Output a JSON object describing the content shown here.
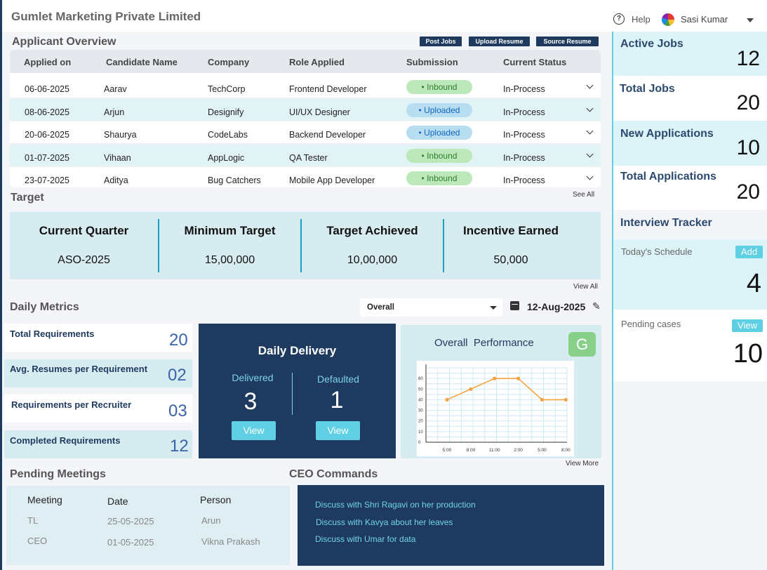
{
  "header": {
    "title": "Gumlet Marketing Private Limited",
    "help_label": "Help",
    "user_name": "Sasi Kumar"
  },
  "applicant_overview": {
    "title": "Applicant Overview",
    "buttons": [
      "Post Jobs",
      "Upload Resume",
      "Source Resume"
    ],
    "columns": [
      "Applied on",
      "Candidate Name",
      "Company",
      "Role Applied",
      "Submission",
      "Current Status"
    ],
    "rows": [
      {
        "date": "06-06-2025",
        "name": "Aarav",
        "company": "TechCorp",
        "role": "Frontend Developer",
        "submission": "• Inbound",
        "status": "In-Process"
      },
      {
        "date": "08-06-2025",
        "name": "Arjun",
        "company": "Designify",
        "role": "UI/UX Designer",
        "submission": "• Uploaded",
        "status": "In-Process"
      },
      {
        "date": "20-06-2025",
        "name": "Shaurya",
        "company": "CodeLabs",
        "role": "Backend Developer",
        "submission": "• Uploaded",
        "status": "In-Process"
      },
      {
        "date": "01-07-2025",
        "name": "Vihaan",
        "company": "AppLogic",
        "role": "QA Tester",
        "submission": "• Inbound",
        "status": "In-Process"
      },
      {
        "date": "23-07-2025",
        "name": "Aditya",
        "company": "Bug Catchers",
        "role": "Mobile App Developer",
        "submission": "• Inbound",
        "status": "In-Process"
      }
    ]
  },
  "target": {
    "title": "Target",
    "see_all": "See All",
    "view_all": "View All",
    "columns": [
      {
        "head": "Current Quarter",
        "value": "ASO-2025"
      },
      {
        "head": "Minimum Target",
        "value": "15,00,000"
      },
      {
        "head": "Target Achieved",
        "value": "10,00,000"
      },
      {
        "head": "Incentive Earned",
        "value": "50,000"
      }
    ]
  },
  "daily_metrics": {
    "title": "Daily Metrics",
    "filter_value": "Overall",
    "date": "12-Aug-2025",
    "metrics": [
      {
        "label": "Total Requirements",
        "value": "20"
      },
      {
        "label": "Avg. Resumes per Requirement",
        "value": "02"
      },
      {
        "label": "Requirements per Recruiter",
        "value": "03"
      },
      {
        "label": "Completed Requirements",
        "value": "12"
      }
    ]
  },
  "daily_delivery": {
    "title": "Daily Delivery",
    "delivered_label": "Delivered",
    "delivered_value": "3",
    "defaulted_label": "Defaulted",
    "defaulted_value": "1",
    "view_label": "View"
  },
  "performance": {
    "title": "Overall  Performance",
    "badge": "G",
    "view_more": "View More"
  },
  "chart_data": {
    "type": "line",
    "x": [
      "5:00",
      "8:00",
      "11:00",
      "2:00",
      "5:00",
      "8:00"
    ],
    "values": [
      40,
      50,
      60,
      60,
      40,
      40
    ],
    "ylim": [
      0,
      70
    ],
    "yticks": [
      0,
      10,
      20,
      30,
      40,
      50,
      60
    ],
    "grid": true,
    "color": "#f4a340"
  },
  "pending_meetings": {
    "title": "Pending Meetings",
    "columns": [
      "Meeting",
      "Date",
      "Person"
    ],
    "rows": [
      {
        "meeting": "TL",
        "date": "25-05-2025",
        "person": "Arun"
      },
      {
        "meeting": "CEO",
        "date": "01-05-2025",
        "person": "Vikna Prakash"
      }
    ]
  },
  "ceo_commands": {
    "title": "CEO Commands",
    "items": [
      "Discuss with Shri Ragavi on her production",
      "Discuss with Kavya about her leaves",
      "Discuss with Umar for data"
    ]
  },
  "sidebar": {
    "stats": [
      {
        "label": "Active Jobs",
        "value": "12"
      },
      {
        "label": "Total Jobs",
        "value": "20"
      },
      {
        "label": "New Applications",
        "value": "10"
      },
      {
        "label": "Total Applications",
        "value": "20"
      }
    ],
    "interview_tracker": "Interview Tracker",
    "schedule_label": "Today's Schedule",
    "schedule_btn": "Add",
    "schedule_value": "4",
    "pending_label": "Pending cases",
    "pending_btn": "View",
    "pending_value": "10"
  },
  "colors": {
    "navy": "#1f3a5f",
    "cyan": "#5fcfe3",
    "light_teal": "#d7ecf1",
    "inbound_green": "#bde8b9",
    "uploaded_blue": "#b6def0"
  }
}
